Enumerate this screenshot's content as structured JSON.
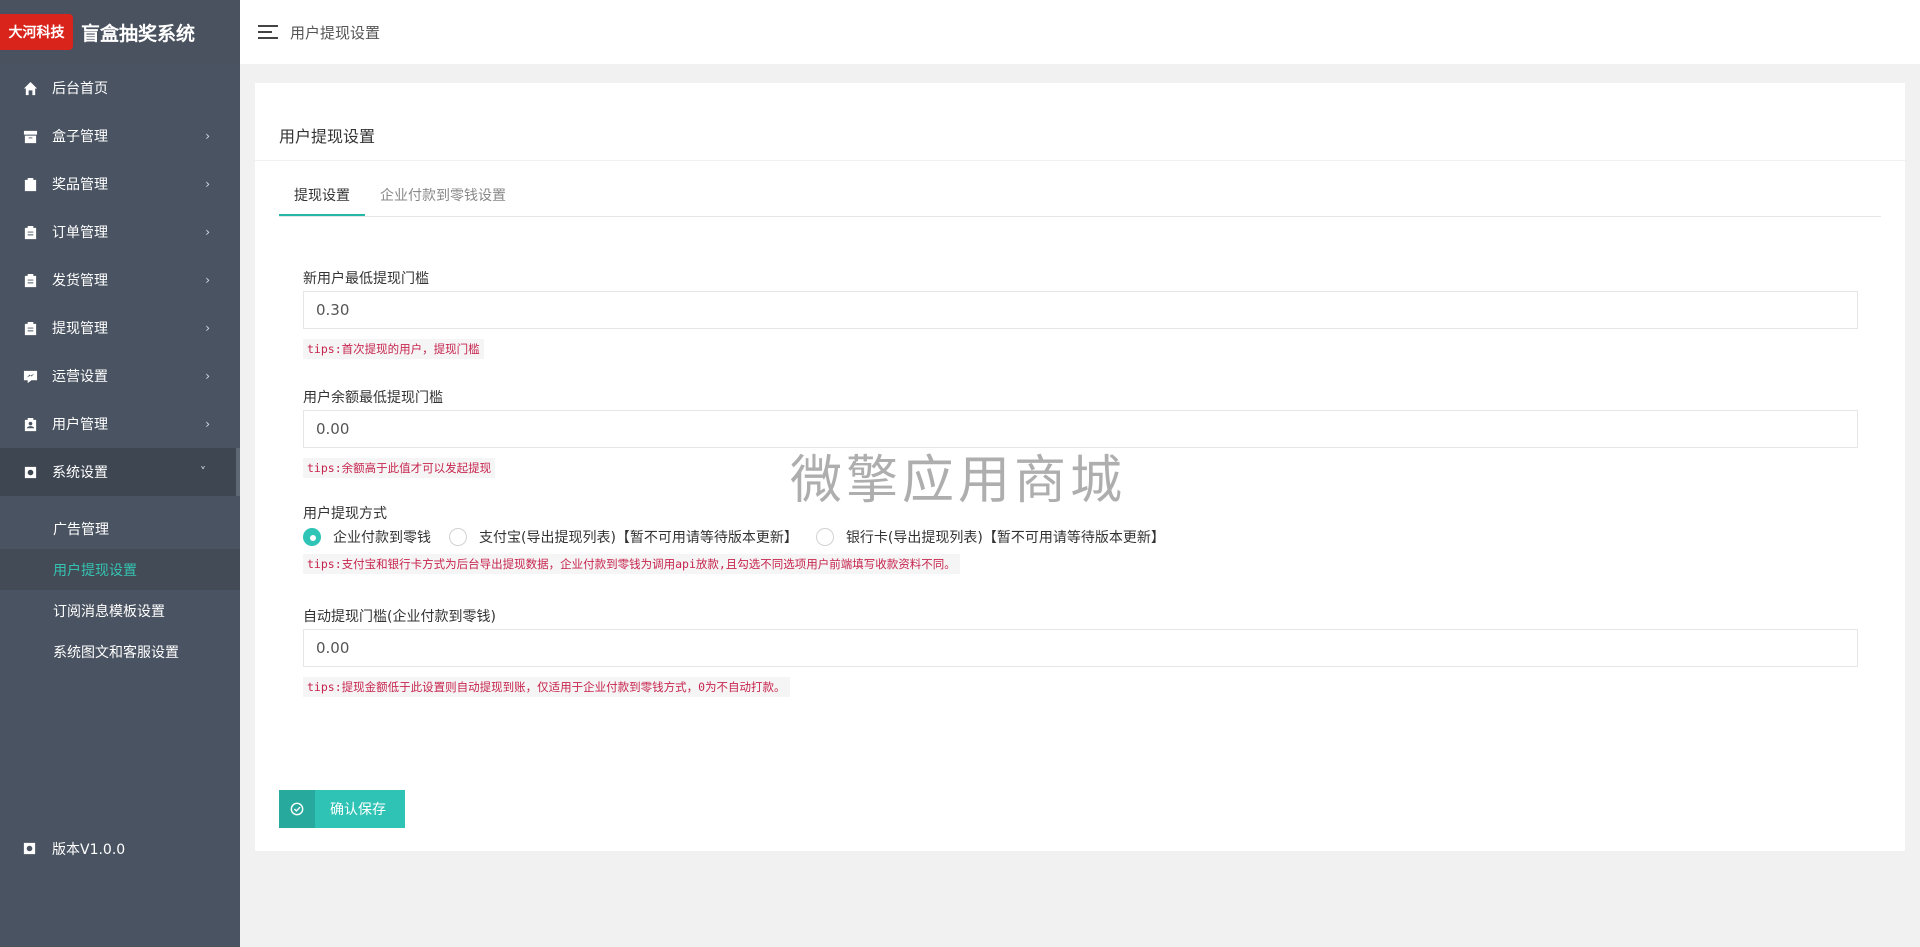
{
  "brand": {
    "logo_text": "大河科技",
    "title": "盲盒抽奖系统"
  },
  "sidebar": {
    "items": [
      {
        "label": "后台首页",
        "icon": "home-icon",
        "has_arrow": false
      },
      {
        "label": "盒子管理",
        "icon": "archive-icon",
        "has_arrow": true
      },
      {
        "label": "奖品管理",
        "icon": "gift-icon",
        "has_arrow": true
      },
      {
        "label": "订单管理",
        "icon": "clipboard-icon",
        "has_arrow": true
      },
      {
        "label": "发货管理",
        "icon": "clipboard-icon",
        "has_arrow": true
      },
      {
        "label": "提现管理",
        "icon": "clipboard-icon",
        "has_arrow": true
      },
      {
        "label": "运营设置",
        "icon": "chart-icon",
        "has_arrow": true
      },
      {
        "label": "用户管理",
        "icon": "user-badge-icon",
        "has_arrow": true
      },
      {
        "label": "系统设置",
        "icon": "gear-icon",
        "has_arrow": true
      }
    ],
    "submenu": [
      "广告管理",
      "用户提现设置",
      "订阅消息模板设置",
      "系统图文和客服设置"
    ],
    "version": "版本V1.0.0"
  },
  "header": {
    "title": "用户提现设置"
  },
  "card": {
    "title": "用户提现设置",
    "tabs": [
      "提现设置",
      "企业付款到零钱设置"
    ]
  },
  "form": {
    "min_new_user": {
      "label": "新用户最低提现门槛",
      "value": "0.30",
      "tip": "tips:首次提现的用户，提现门槛"
    },
    "min_balance": {
      "label": "用户余额最低提现门槛",
      "value": "0.00",
      "tip": "tips:余额高于此值才可以发起提现"
    },
    "method": {
      "label": "用户提现方式",
      "options": [
        "企业付款到零钱",
        "支付宝(导出提现列表)【暂不可用请等待版本更新】",
        "银行卡(导出提现列表)【暂不可用请等待版本更新】"
      ],
      "selected": "企业付款到零钱",
      "tip": "tips:支付宝和银行卡方式为后台导出提现数据，企业付款到零钱为调用api放款,且勾选不同选项用户前端填写收款资料不同。"
    },
    "auto_threshold": {
      "label": "自动提现门槛(企业付款到零钱)",
      "value": "0.00",
      "tip": "tips:提现金额低于此设置则自动提现到账，仅适用于企业付款到零钱方式，0为不自动打款。"
    },
    "save_label": "确认保存"
  },
  "watermark": "微擎应用商城",
  "colors": {
    "accent": "#2ec4b6",
    "sidebar_bg": "#4a5361",
    "brand_red": "#d9241c",
    "tip_red": "#c7254e"
  }
}
